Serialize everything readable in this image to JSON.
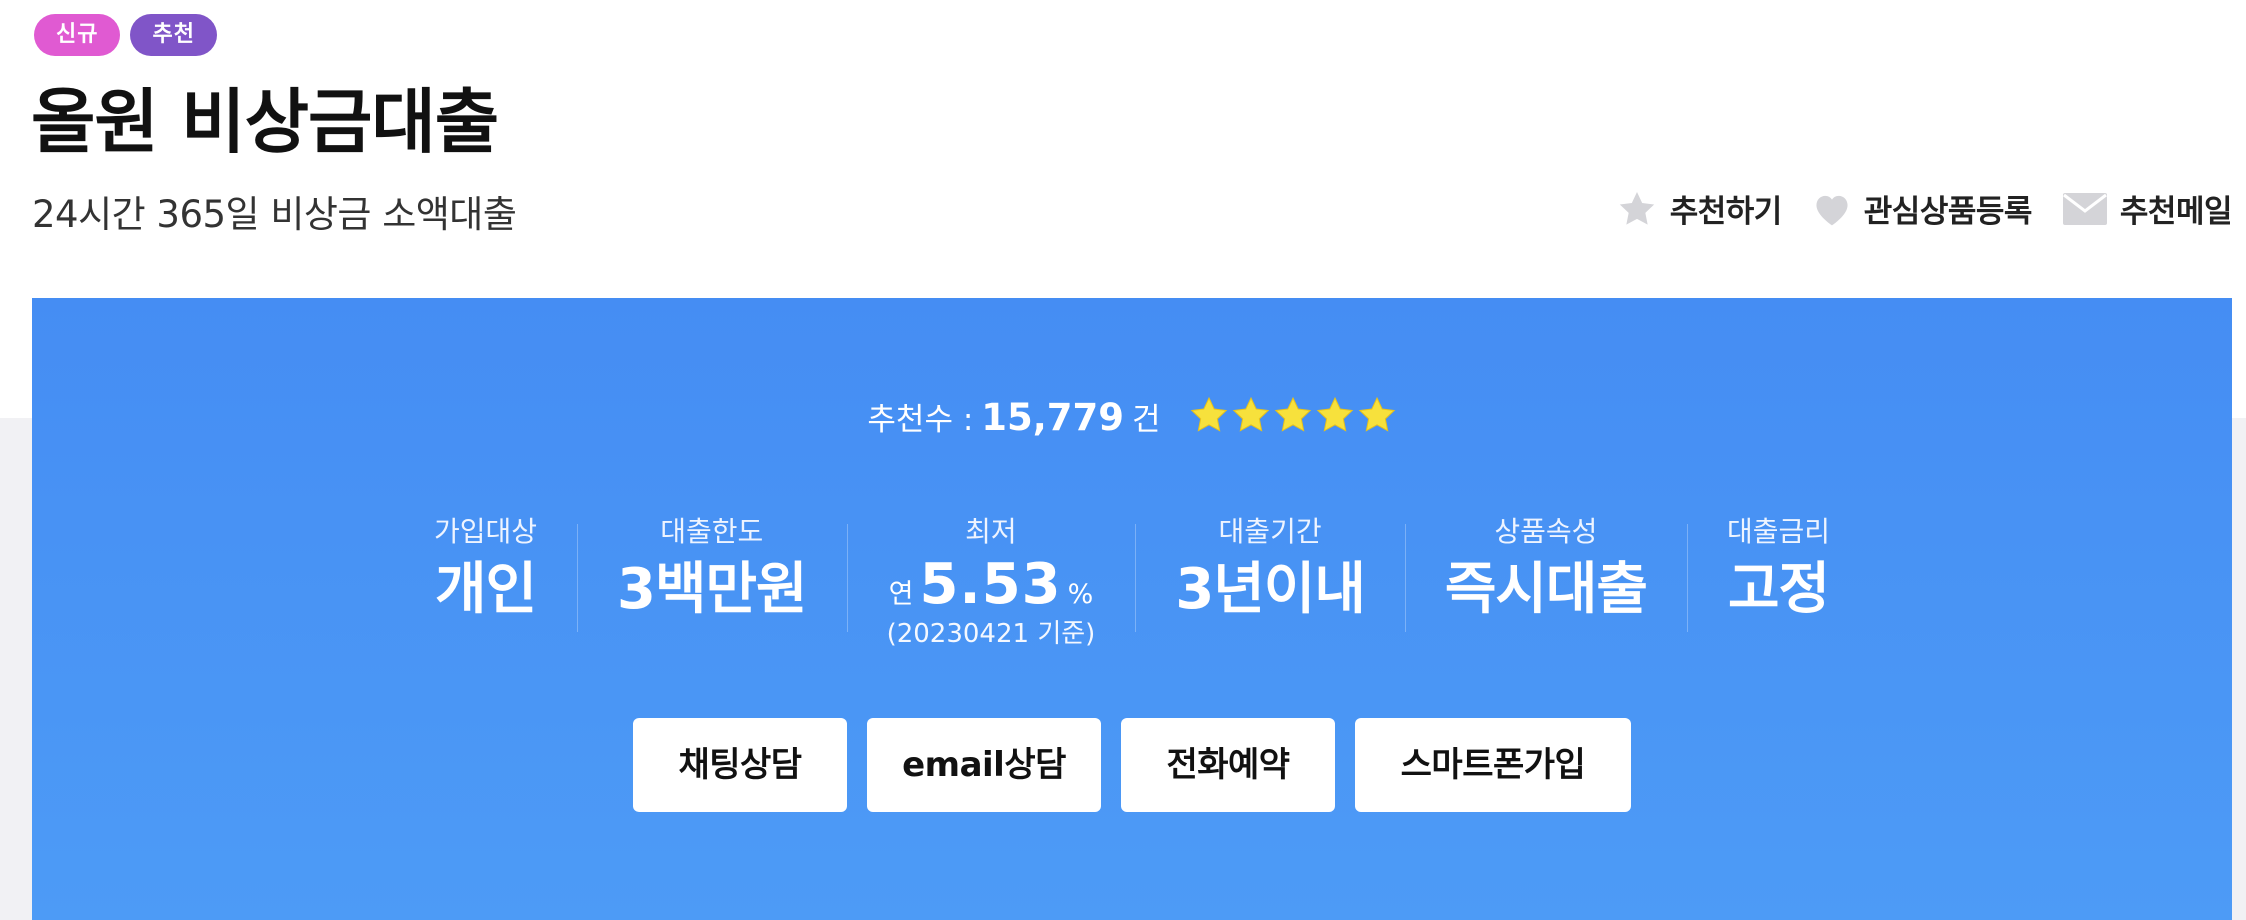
{
  "header": {
    "badges": [
      "신규",
      "추천"
    ],
    "title": "올원 비상금대출",
    "subtitle": "24시간 365일 비상금 소액대출",
    "actions": [
      {
        "label": "추천하기",
        "icon": "star-icon"
      },
      {
        "label": "관심상품등록",
        "icon": "heart-icon"
      },
      {
        "label": "추천메일",
        "icon": "mail-icon"
      }
    ]
  },
  "summary": {
    "recommend_label": "추천수 :",
    "recommend_count": "15,779",
    "recommend_unit": "건",
    "rating": {
      "stars": 5,
      "max": 5
    },
    "star_color": "#f7e13c"
  },
  "specs": [
    {
      "label": "가입대상",
      "value": "개인"
    },
    {
      "label": "대출한도",
      "value": "3백만원"
    },
    {
      "label": "최저",
      "prefix": "연",
      "value": "5.53",
      "unit": "%",
      "note": "(20230421 기준)"
    },
    {
      "label": "대출기간",
      "value": "3년이내"
    },
    {
      "label": "상품속성",
      "value": "즉시대출"
    },
    {
      "label": "대출금리",
      "value": "고정"
    }
  ],
  "buttons": [
    "채팅상담",
    "email상담",
    "전화예약",
    "스마트폰가입"
  ],
  "colors": {
    "panel": "#4a94f5",
    "badge_new": "#e05ad2",
    "badge_recommend": "#8055c8"
  }
}
